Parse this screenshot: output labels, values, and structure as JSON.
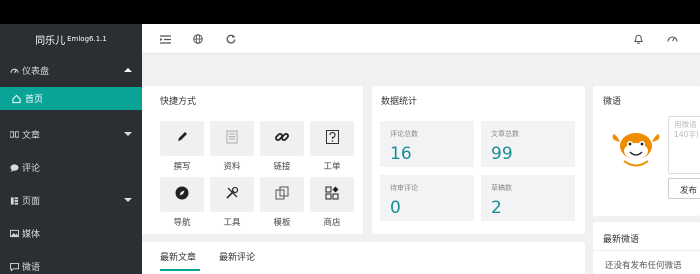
{
  "brand": {
    "name": "同乐儿",
    "version": "Emlog6.1.1"
  },
  "sidebar": {
    "items": [
      {
        "label": "仪表盘",
        "icon": "dashboard-icon"
      },
      {
        "label": "首页",
        "icon": "home-icon"
      },
      {
        "label": "文章",
        "icon": "article-icon"
      },
      {
        "label": "评论",
        "icon": "comment-icon"
      },
      {
        "label": "页面",
        "icon": "page-icon"
      },
      {
        "label": "媒体",
        "icon": "media-icon"
      },
      {
        "label": "微语",
        "icon": "micro-post-icon"
      }
    ]
  },
  "shortcuts": {
    "title": "快捷方式",
    "items": [
      {
        "label": "撰写",
        "icon": "pencil-icon"
      },
      {
        "label": "资料",
        "icon": "document-icon"
      },
      {
        "label": "链接",
        "icon": "link-icon"
      },
      {
        "label": "工单",
        "icon": "ticket-icon"
      },
      {
        "label": "导航",
        "icon": "compass-icon"
      },
      {
        "label": "工具",
        "icon": "tools-icon"
      },
      {
        "label": "模板",
        "icon": "template-icon"
      },
      {
        "label": "商店",
        "icon": "store-icon"
      }
    ]
  },
  "stats": {
    "title": "数据统计",
    "items": [
      {
        "label": "评论总数",
        "value": "16"
      },
      {
        "label": "文章总数",
        "value": "99"
      },
      {
        "label": "待审评论",
        "value": "0"
      },
      {
        "label": "草稿数",
        "value": "2"
      }
    ]
  },
  "weiyu": {
    "title": "微语",
    "placeholder_line1": "用微语",
    "placeholder_line2": "140字)",
    "publish_label": "发布"
  },
  "latest_weiyu": {
    "title": "最新微语",
    "empty_text": "还没有发布任何微语"
  },
  "tabs": {
    "latest_articles": "最新文章",
    "latest_comments": "最新评论"
  },
  "colors": {
    "accent": "#0aa398",
    "sidebar_bg": "#2b2f33",
    "stat_number": "#1a8d95",
    "mascot": "#f08c00"
  }
}
